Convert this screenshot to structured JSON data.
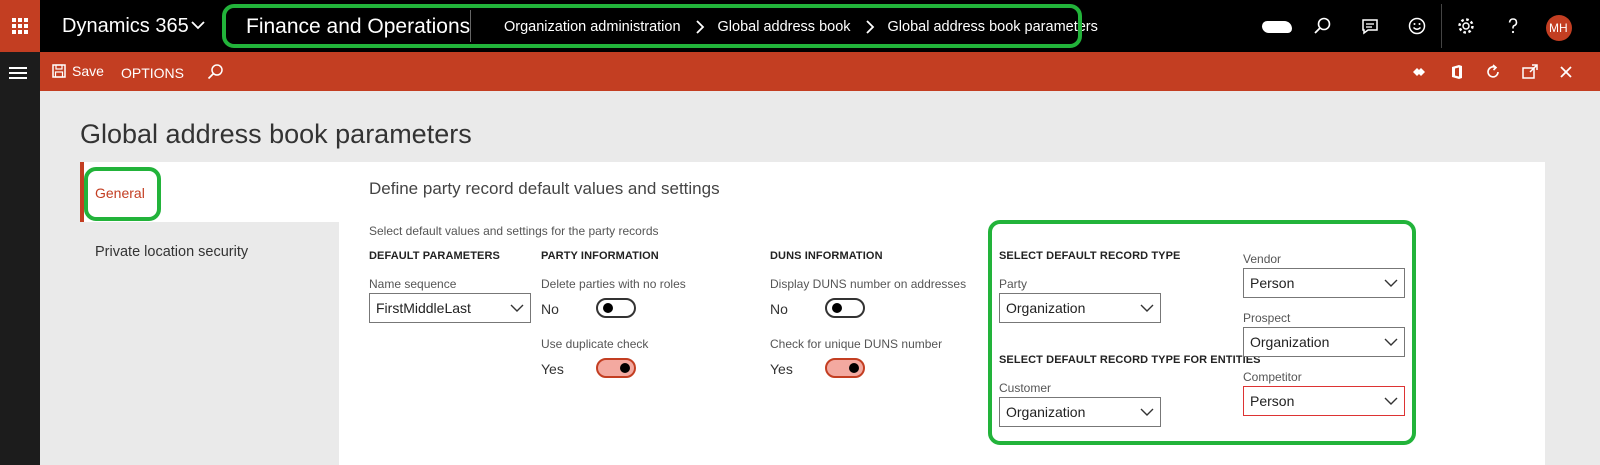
{
  "header": {
    "app_title": "Dynamics 365",
    "module_name": "Finance and Operations",
    "breadcrumb": [
      "Organization administration",
      "Global address book",
      "Global address book parameters"
    ],
    "avatar_initials": "MH",
    "icons": [
      "waffle-icon",
      "chevron-down-icon",
      "search-icon",
      "feedback-icon",
      "smiley-icon",
      "gear-icon",
      "help-icon"
    ],
    "brand_color": "#c33e22",
    "highlight_color": "#22b33a"
  },
  "actionbar": {
    "save_label": "Save",
    "options_label": "OPTIONS",
    "icons": [
      "save-icon",
      "search-icon",
      "connect-icon",
      "office-icon",
      "refresh-icon",
      "open-new-window-icon",
      "close-icon"
    ]
  },
  "page": {
    "title": "Global address book parameters"
  },
  "tabs": [
    {
      "label": "General",
      "selected": true
    },
    {
      "label": "Private location security",
      "selected": false
    }
  ],
  "section": {
    "title": "Define party record default values and settings",
    "description": "Select default values and settings for the party records"
  },
  "default_parameters": {
    "heading": "DEFAULT PARAMETERS",
    "name_sequence_label": "Name sequence",
    "name_sequence_value": "FirstMiddleLast"
  },
  "party_information": {
    "heading": "PARTY INFORMATION",
    "delete_label": "Delete parties with no roles",
    "delete_value": "No",
    "duplicate_label": "Use duplicate check",
    "duplicate_value": "Yes"
  },
  "duns_information": {
    "heading": "DUNS INFORMATION",
    "display_label": "Display DUNS number on addresses",
    "display_value": "No",
    "unique_label": "Check for unique DUNS number",
    "unique_value": "Yes"
  },
  "record_type": {
    "heading": "SELECT DEFAULT RECORD TYPE",
    "party_label": "Party",
    "party_value": "Organization",
    "entities_heading": "SELECT DEFAULT RECORD TYPE FOR ENTITIES",
    "customer_label": "Customer",
    "customer_value": "Organization",
    "vendor_label": "Vendor",
    "vendor_value": "Person",
    "prospect_label": "Prospect",
    "prospect_value": "Organization",
    "competitor_label": "Competitor",
    "competitor_value": "Person"
  }
}
